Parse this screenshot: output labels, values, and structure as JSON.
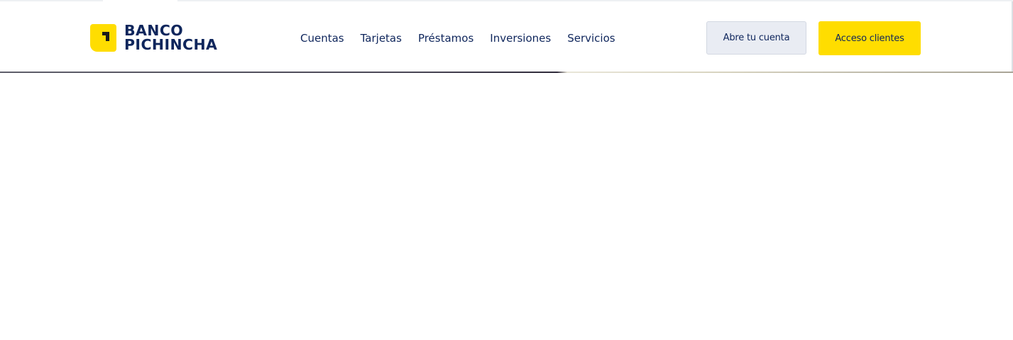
{
  "brand": {
    "line1": "BANCO",
    "line2": "PICHINCHA",
    "logo_icon": "banco-pichincha-logo-icon",
    "accent_color": "#ffdd00",
    "text_color": "#0f265c"
  },
  "nav": {
    "items": [
      {
        "label": "Cuentas"
      },
      {
        "label": "Tarjetas"
      },
      {
        "label": "Préstamos"
      },
      {
        "label": "Inversiones"
      },
      {
        "label": "Servicios"
      }
    ]
  },
  "actions": {
    "open_account_label": "Abre tu cuenta",
    "client_access_label": "Acceso clientes"
  }
}
